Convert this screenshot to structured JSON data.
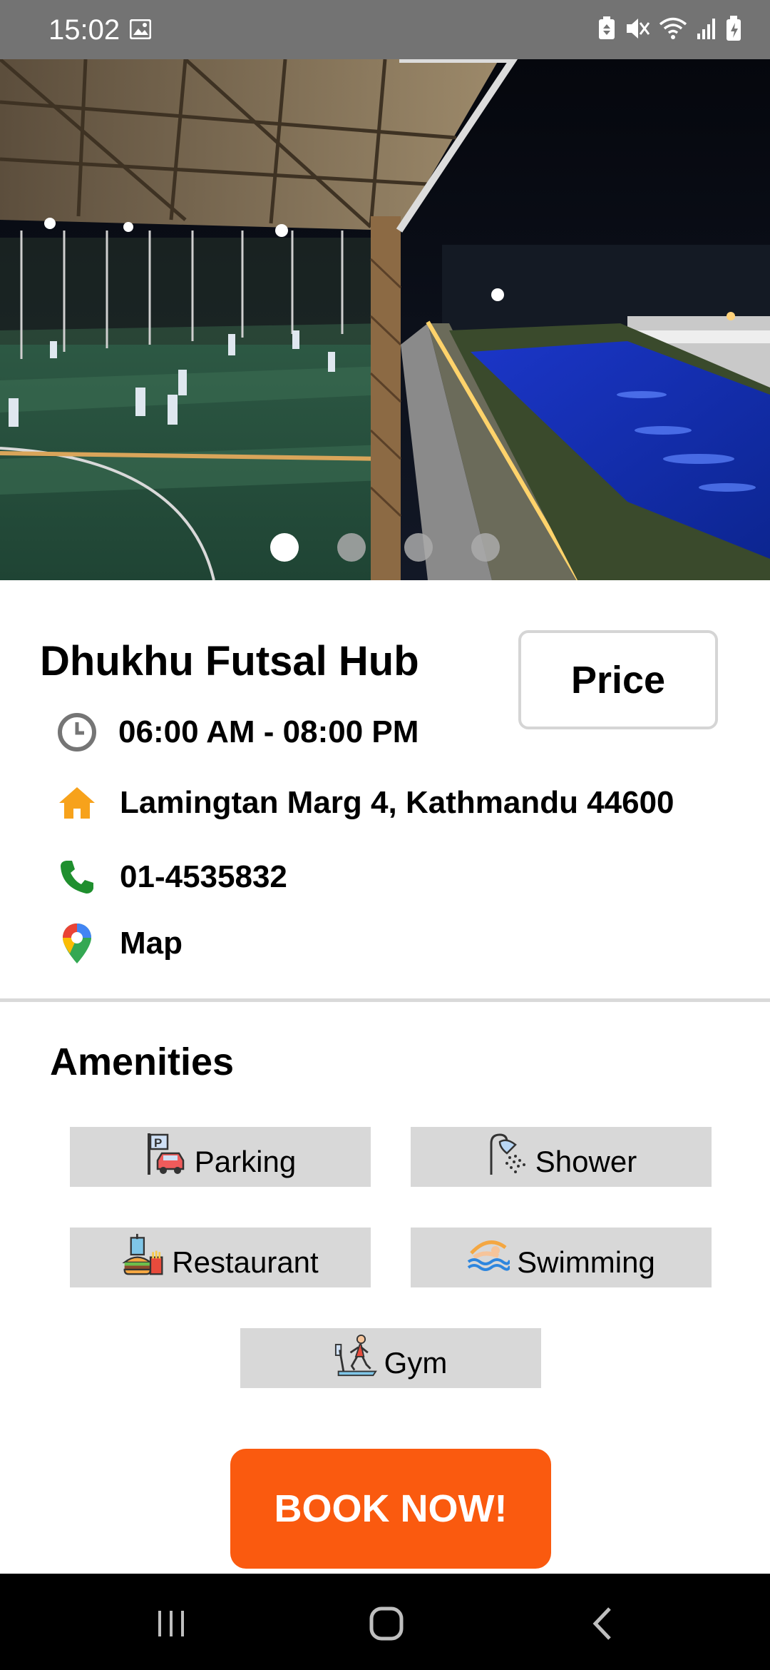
{
  "status_bar": {
    "time": "15:02",
    "left_icons": [
      "image-icon"
    ],
    "right_icons": [
      "battery-saver-icon",
      "mute-icon",
      "wifi-icon",
      "signal-icon",
      "battery-charging-icon"
    ]
  },
  "hero": {
    "image_description_icon": "photo-futsal-and-pool",
    "carousel_dots": 4,
    "active_dot": 1
  },
  "venue": {
    "name": "Dhukhu Futsal Hub",
    "price_label": "Price",
    "hours": "06:00 AM - 08:00 PM",
    "address": "Lamingtan Marg 4, Kathmandu 44600",
    "phone": "01-4535832",
    "map_label": "Map"
  },
  "amenities": {
    "title": "Amenities",
    "items": [
      {
        "label": "Parking",
        "icon": "parking-icon"
      },
      {
        "label": "Shower",
        "icon": "shower-icon"
      },
      {
        "label": "Restaurant",
        "icon": "restaurant-icon"
      },
      {
        "label": "Swimming",
        "icon": "swimming-icon"
      },
      {
        "label": "Gym",
        "icon": "gym-icon"
      }
    ]
  },
  "actions": {
    "book_label": "BOOK NOW!"
  },
  "colors": {
    "accent": "#fa5a0f",
    "status_bar": "#737373",
    "amenity_bg": "#d8d8d8",
    "home_icon": "#f7a21b",
    "phone_icon": "#1f8f2e"
  },
  "nav_bar": {
    "buttons": [
      "recent-apps-icon",
      "home-icon",
      "back-icon"
    ]
  }
}
